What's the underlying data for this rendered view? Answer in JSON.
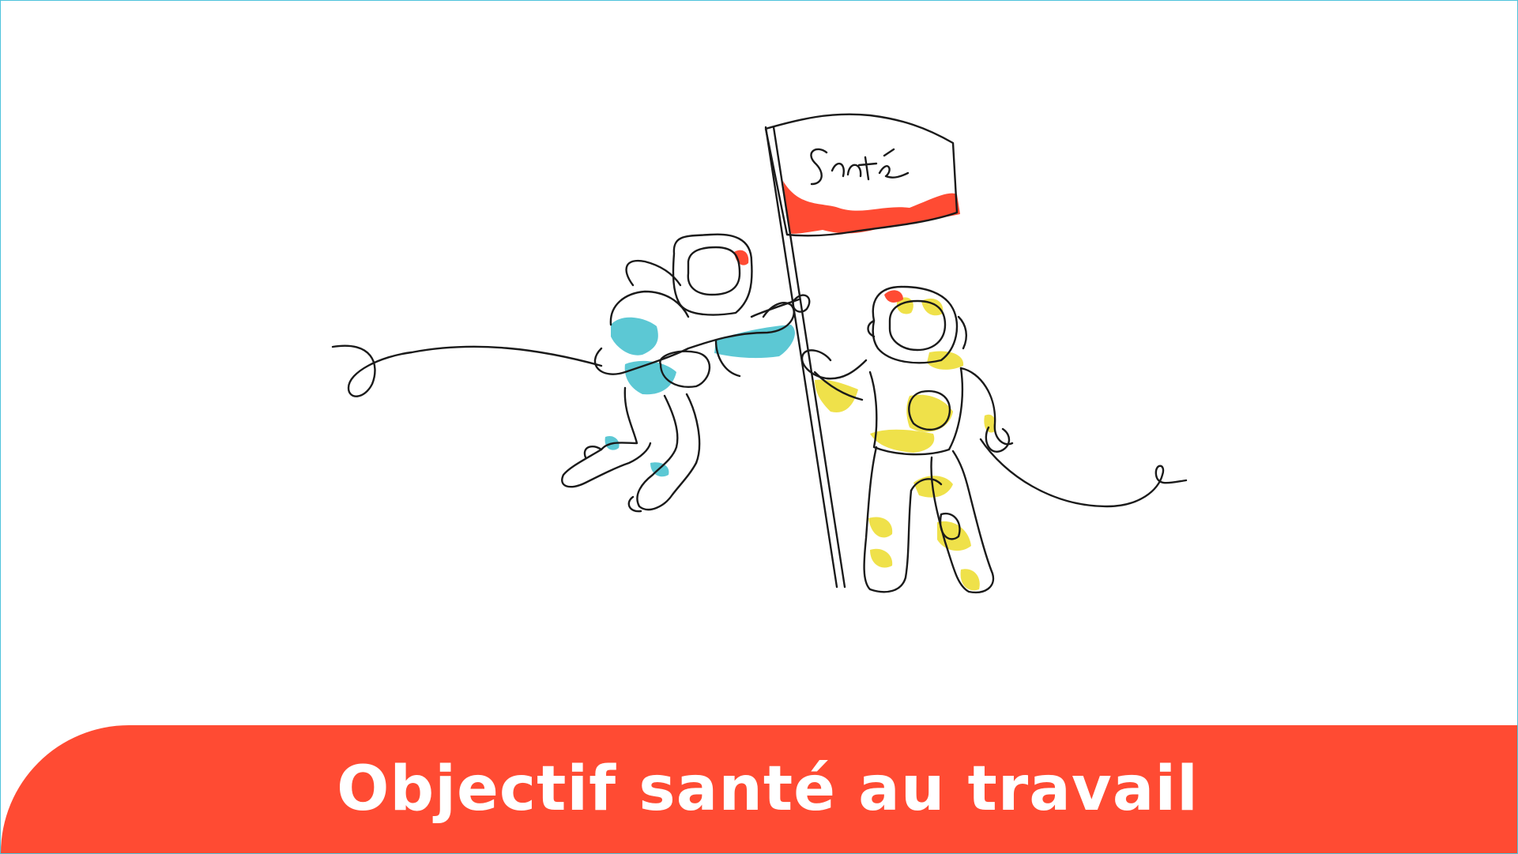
{
  "banner": {
    "title": "Objectif santé au travail"
  },
  "illustration": {
    "flag_text": "Santé"
  },
  "colors": {
    "banner": "#ff4b33",
    "cyan_suit": "#5cc8d4",
    "yellow_suit": "#efe14a",
    "flag_red": "#ff4b33",
    "line": "#1a1a1a"
  }
}
